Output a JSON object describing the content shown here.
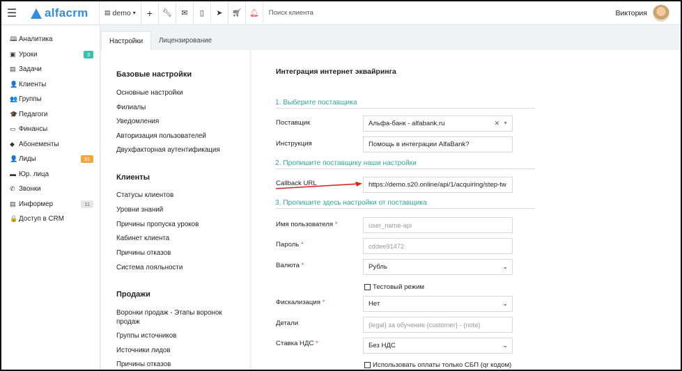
{
  "topbar": {
    "brand": "alfacrm",
    "account": "demo",
    "account_caret": "▾",
    "add_symbol": "+",
    "search_placeholder": "Поиск клиента",
    "user_name": "Виктория"
  },
  "sidebar": {
    "items": [
      {
        "icon": "🕮",
        "label": "Аналитика",
        "badge": ""
      },
      {
        "icon": "▣",
        "label": "Уроки",
        "badge": "3"
      },
      {
        "icon": "▤",
        "label": "Задачи",
        "badge": ""
      },
      {
        "icon": "👤",
        "label": "Клиенты",
        "badge": ""
      },
      {
        "icon": "👥",
        "label": "Группы",
        "badge": ""
      },
      {
        "icon": "🎓",
        "label": "Педагоги",
        "badge": ""
      },
      {
        "icon": "▭",
        "label": "Финансы",
        "badge": ""
      },
      {
        "icon": "◆",
        "label": "Абонементы",
        "badge": ""
      },
      {
        "icon": "👤",
        "label": "Лиды",
        "badge": "31"
      },
      {
        "icon": "▬",
        "label": "Юр. лица",
        "badge": ""
      },
      {
        "icon": "✆",
        "label": "Звонки",
        "badge": ""
      },
      {
        "icon": "▤",
        "label": "Информер",
        "badge": "11"
      },
      {
        "icon": "🔒",
        "label": "Доступ в CRM",
        "badge": ""
      }
    ]
  },
  "tabs": [
    {
      "label": "Настройки",
      "active": true
    },
    {
      "label": "Лицензирование",
      "active": false
    }
  ],
  "settings_nav": {
    "base_title": "Базовые настройки",
    "base_links": [
      "Основные настройки",
      "Филиалы",
      "Уведомления",
      "Авторизация пользователей",
      "Двухфакторная аутентификация"
    ],
    "clients_title": "Клиенты",
    "clients_links": [
      "Статусы клиентов",
      "Уровни знаний",
      "Причины пропуска уроков",
      "Кабинет клиента",
      "Причины отказов",
      "Система лояльности"
    ],
    "sales_title": "Продажи",
    "sales_links": [
      "Воронки продаж - Этапы воронок продаж",
      "Группы источников",
      "Источники лидов",
      "Причины отказов"
    ]
  },
  "form": {
    "title": "Интеграция интернет эквайринга",
    "step1": "1. Выберите поставщика",
    "step2": "2. Пропишите поставщику наши настройки",
    "step3": "3. Пропишите здесь настройки от поставщика",
    "provider_label": "Поставщик",
    "provider_value": "Альфа-банк - alfabank.ru",
    "instruction_label": "Инструкция",
    "instruction_value": "Помощь в интеграции AlfaBank?",
    "callback_label": "Callback URL",
    "callback_value": "https://demo.s20.online/api/1/acquiring/step-tw",
    "username_label": "Имя пользователя",
    "username_placeholder": "user_name-api",
    "password_label": "Пароль",
    "password_placeholder": "cddee91472",
    "currency_label": "Валюта",
    "currency_value": "Рубль",
    "test_mode_label": "Тестовый режим",
    "fiscal_label": "Фискализация",
    "fiscal_value": "Нет",
    "details_label": "Детали",
    "details_placeholder": "{legal} за обучение {customer} - {note}",
    "vat_label": "Ставка НДС",
    "vat_value": "Без НДС",
    "sbp_label": "Использовать оплаты только СБП (qr кодом)",
    "required_mark": "*"
  },
  "colors": {
    "brand": "#2f8ee0",
    "step_heading": "#2ea89a",
    "required": "#d9534f",
    "arrow": "#e02020",
    "badge_green": "#3cbfae",
    "badge_orange": "#f5a540"
  },
  "icons": [
    "hamburger-icon",
    "calendar-icon",
    "plus-icon",
    "wrench-icon",
    "mail-icon",
    "phone-icon",
    "telegram-icon",
    "cart-icon",
    "bell-icon"
  ]
}
